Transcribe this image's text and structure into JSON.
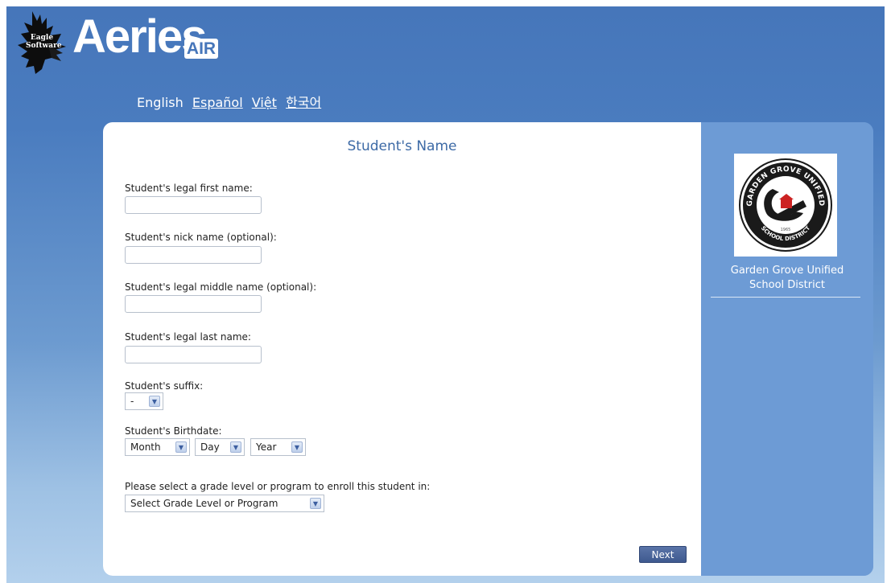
{
  "header": {
    "eagle_text": "Eagle\nSoftware",
    "brand": "Aeries",
    "brand_badge": "AIR"
  },
  "languages": {
    "current": "English",
    "links": [
      "Español",
      "Việt",
      "한국어"
    ]
  },
  "form": {
    "title": "Student's Name",
    "first_name_label": "Student's legal first name:",
    "first_name_value": "",
    "nick_name_label": "Student's nick name (optional):",
    "nick_name_value": "",
    "middle_name_label": "Student's legal middle name (optional):",
    "middle_name_value": "",
    "last_name_label": "Student's legal last name:",
    "last_name_value": "",
    "suffix_label": "Student's suffix:",
    "suffix_value": "-",
    "birthdate_label": "Student's Birthdate:",
    "month_value": "Month",
    "day_value": "Day",
    "year_value": "Year",
    "grade_label": "Please select a grade level or program to enroll this student in:",
    "grade_value": "Select Grade Level or Program",
    "next_button": "Next"
  },
  "district": {
    "name_line1": "Garden Grove Unified",
    "name_line2": "School District",
    "seal_top_text": "GARDEN GROVE UNIFIED",
    "seal_bottom_text": "SCHOOL DISTRICT",
    "seal_year": "1965"
  },
  "colors": {
    "page_blue": "#4676ba",
    "panel_blue": "#6d9bd5",
    "title_blue": "#3d6aa6",
    "button": "#4a6599"
  }
}
